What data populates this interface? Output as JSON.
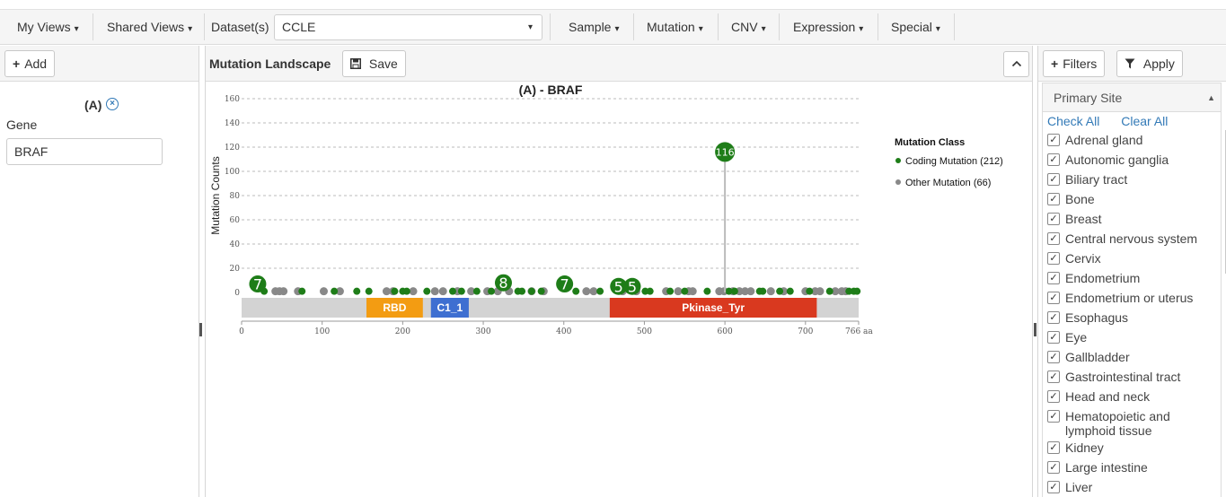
{
  "topbar": {
    "menus": [
      {
        "label": "My Views",
        "caret": "▾"
      },
      {
        "label": "Shared Views",
        "caret": "▾"
      }
    ],
    "dataset_label": "Dataset(s)",
    "dataset_value": "CCLE",
    "dataset_caret": "▾",
    "right_menus": [
      {
        "label": "Sample",
        "caret": "▾"
      },
      {
        "label": "Mutation",
        "caret": "▾"
      },
      {
        "label": "CNV",
        "caret": "▾"
      },
      {
        "label": "Expression",
        "caret": "▾"
      },
      {
        "label": "Special",
        "caret": "▾"
      }
    ]
  },
  "left": {
    "add_icon": "+",
    "add_label": "Add",
    "view_title": "(A)",
    "close_icon": "×",
    "gene_label": "Gene",
    "gene_value": "BRAF"
  },
  "mid": {
    "title": "Mutation Landscape",
    "save_label": "Save",
    "collapse_icon": "^"
  },
  "right": {
    "filters_icon": "+",
    "filters_label": "Filters",
    "apply_label": "Apply",
    "primary_site_title": "Primary Site",
    "check_all": "Check All",
    "clear_all": "Clear All",
    "check_mark": "✓",
    "sites": [
      "Adrenal gland",
      "Autonomic ganglia",
      "Biliary tract",
      "Bone",
      "Breast",
      "Central nervous system",
      "Cervix",
      "Endometrium",
      "Endometrium or uterus",
      "Esophagus",
      "Eye",
      "Gallbladder",
      "Gastrointestinal tract",
      "Head and neck",
      "Hematopoietic and lymphoid tissue",
      "Kidney",
      "Large intestine",
      "Liver"
    ]
  },
  "chart_data": {
    "type": "scatter",
    "title": "(A) - BRAF",
    "ylabel": "Mutation Counts",
    "ylim": [
      0,
      160
    ],
    "xlim": [
      0,
      766
    ],
    "yticks": [
      0,
      20,
      40,
      60,
      80,
      100,
      120,
      140,
      160
    ],
    "xticks": [
      0,
      100,
      200,
      300,
      400,
      500,
      600,
      700
    ],
    "xmax_label": "766 aa",
    "grid": true,
    "legend": {
      "title": "Mutation Class",
      "placement": "right",
      "entries": [
        {
          "label": "Coding Mutation (212)",
          "color": "#1e7d18"
        },
        {
          "label": "Other Mutation (66)",
          "color": "#888888"
        }
      ]
    },
    "domains": [
      {
        "name": "RBD",
        "start": 155,
        "end": 225,
        "color": "#f39c12"
      },
      {
        "name": "C1_1",
        "start": 235,
        "end": 282,
        "color": "#3e6fd1"
      },
      {
        "name": "Pkinase_Tyr",
        "start": 457,
        "end": 714,
        "color": "#d9391f"
      }
    ],
    "backbone_color": "#d3d3d3",
    "labeled_points": [
      {
        "x": 20,
        "y": 7,
        "label": "7",
        "class": "coding"
      },
      {
        "x": 325,
        "y": 8,
        "label": "8",
        "class": "coding"
      },
      {
        "x": 401,
        "y": 7,
        "label": "7",
        "class": "coding"
      },
      {
        "x": 468,
        "y": 5,
        "label": "5",
        "class": "coding"
      },
      {
        "x": 485,
        "y": 5,
        "label": "5",
        "class": "coding"
      },
      {
        "x": 600,
        "y": 116,
        "label": "116",
        "class": "coding"
      }
    ],
    "coding_points_x": [
      28,
      75,
      115,
      143,
      158,
      190,
      200,
      205,
      230,
      262,
      273,
      292,
      310,
      343,
      348,
      360,
      372,
      415,
      445,
      469,
      501,
      507,
      532,
      550,
      578,
      605,
      612,
      643,
      647,
      668,
      681,
      705,
      730,
      754,
      760,
      764
    ],
    "other_points_x": [
      42,
      47,
      52,
      70,
      102,
      122,
      180,
      188,
      213,
      240,
      250,
      268,
      285,
      305,
      318,
      332,
      360,
      375,
      428,
      437,
      473,
      490,
      527,
      542,
      555,
      560,
      593,
      599,
      610,
      618,
      625,
      632,
      657,
      673,
      700,
      712,
      718,
      737,
      745,
      750
    ]
  }
}
